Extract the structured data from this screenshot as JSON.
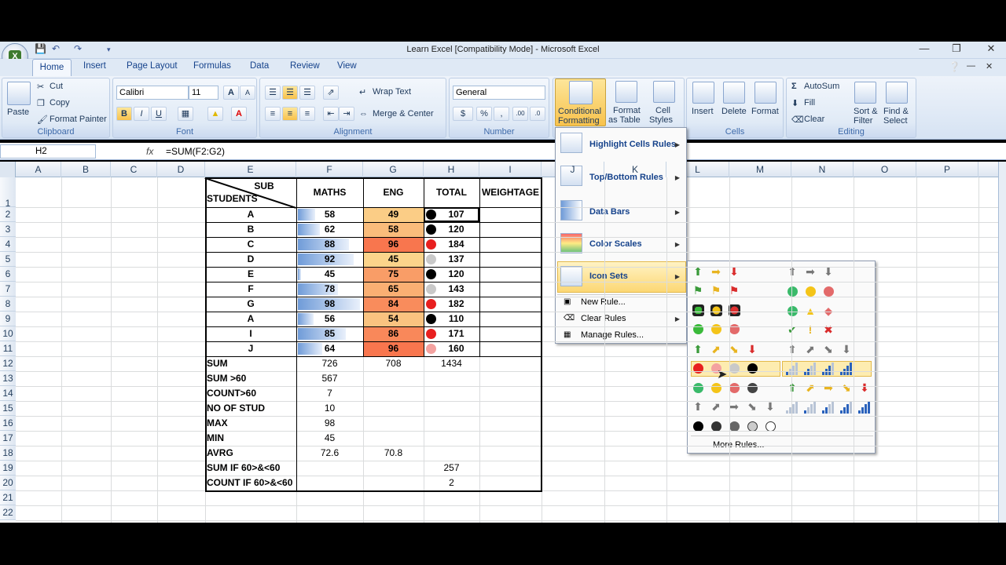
{
  "window": {
    "title": "Learn Excel  [Compatibility Mode] - Microsoft Excel"
  },
  "tabs": [
    "Home",
    "Insert",
    "Page Layout",
    "Formulas",
    "Data",
    "Review",
    "View"
  ],
  "ribbon": {
    "clipboard": {
      "paste": "Paste",
      "cut": "Cut",
      "copy": "Copy",
      "format_painter": "Format Painter",
      "label": "Clipboard"
    },
    "font": {
      "name": "Calibri",
      "size": "11",
      "label": "Font"
    },
    "alignment": {
      "wrap": "Wrap Text",
      "merge": "Merge & Center",
      "label": "Alignment"
    },
    "number": {
      "format": "General",
      "label": "Number"
    },
    "styles": {
      "cf_line1": "Conditional",
      "cf_line2": "Formatting",
      "fat_line1": "Format",
      "fat_line2": "as Table",
      "cs_line1": "Cell",
      "cs_line2": "Styles"
    },
    "cells": {
      "insert": "Insert",
      "delete": "Delete",
      "format": "Format",
      "label": "Cells"
    },
    "editing": {
      "autosum": "AutoSum",
      "fill": "Fill",
      "clear": "Clear",
      "sort_line1": "Sort &",
      "sort_line2": "Filter",
      "find_line1": "Find &",
      "find_line2": "Select",
      "label": "Editing"
    }
  },
  "formula_bar": {
    "name_box": "H2",
    "fx": "fx",
    "formula": "=SUM(F2:G2)"
  },
  "columns": [
    "A",
    "B",
    "C",
    "D",
    "E",
    "F",
    "G",
    "H",
    "I",
    "J",
    "K",
    "L",
    "M",
    "N",
    "O",
    "P"
  ],
  "rows": [
    "1",
    "2",
    "3",
    "4",
    "5",
    "6",
    "7",
    "8",
    "9",
    "10",
    "11",
    "12",
    "13",
    "14",
    "15",
    "16",
    "17",
    "18",
    "19",
    "20",
    "21",
    "22"
  ],
  "table": {
    "header": {
      "sub": "SUB",
      "students": "STUDENTS",
      "maths": "MATHS",
      "eng": "ENG",
      "total": "TOTAL",
      "weightage": "WEIGHTAGE"
    },
    "students": [
      {
        "name": "A",
        "maths": 58,
        "eng": 49,
        "total": 107
      },
      {
        "name": "B",
        "maths": 62,
        "eng": 58,
        "total": 120
      },
      {
        "name": "C",
        "maths": 88,
        "eng": 96,
        "total": 184
      },
      {
        "name": "D",
        "maths": 92,
        "eng": 45,
        "total": 137
      },
      {
        "name": "E",
        "maths": 45,
        "eng": 75,
        "total": 120
      },
      {
        "name": "F",
        "maths": 78,
        "eng": 65,
        "total": 143
      },
      {
        "name": "G",
        "maths": 98,
        "eng": 84,
        "total": 182
      },
      {
        "name": "A",
        "maths": 56,
        "eng": 54,
        "total": 110
      },
      {
        "name": "I",
        "maths": 85,
        "eng": 86,
        "total": 171
      },
      {
        "name": "J",
        "maths": 64,
        "eng": 96,
        "total": 160
      }
    ],
    "summary": [
      {
        "label": "SUM",
        "f": "726",
        "g": "708",
        "h": "1434"
      },
      {
        "label": "SUM >60",
        "f": "567",
        "g": "",
        "h": ""
      },
      {
        "label": "COUNT>60",
        "f": "7",
        "g": "",
        "h": ""
      },
      {
        "label": "NO OF STUD",
        "f": "10",
        "g": "",
        "h": ""
      },
      {
        "label": "MAX",
        "f": "98",
        "g": "",
        "h": ""
      },
      {
        "label": "MIN",
        "f": "45",
        "g": "",
        "h": ""
      },
      {
        "label": "AVRG",
        "f": "72.6",
        "g": "70.8",
        "h": ""
      },
      {
        "label": "SUM IF 60>&<60",
        "f": "",
        "g": "",
        "h": "257"
      },
      {
        "label": "COUNT IF 60>&<60",
        "f": "",
        "g": "",
        "h": "2"
      }
    ]
  },
  "cf_menu": {
    "highlight": "Highlight Cells Rules",
    "topbottom": "Top/Bottom Rules",
    "databars": "Data Bars",
    "colorscales": "Color Scales",
    "iconsets": "Icon Sets",
    "newrule": "New Rule...",
    "clearrules": "Clear Rules",
    "managerules": "Manage Rules..."
  },
  "iconsets_menu": {
    "more_rules": "More Rules..."
  },
  "colors": {
    "accent": "#f8c24c",
    "ribbon": "#dfe9f5",
    "databar": "#6f9bd8",
    "scale_high": "#f8764e",
    "scale_low": "#fbd48b"
  }
}
